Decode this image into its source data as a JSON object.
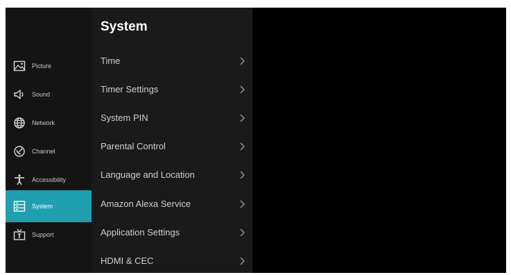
{
  "panel": {
    "title": "System"
  },
  "sidebar": {
    "items": [
      {
        "label": "Picture",
        "icon": "picture-icon"
      },
      {
        "label": "Sound",
        "icon": "speaker-icon"
      },
      {
        "label": "Network",
        "icon": "globe-icon"
      },
      {
        "label": "Channel",
        "icon": "satellite-dish-icon"
      },
      {
        "label": "Accessibility",
        "icon": "accessibility-icon"
      },
      {
        "label": "System",
        "icon": "system-icon",
        "active": true
      },
      {
        "label": "Support",
        "icon": "tv-support-icon"
      }
    ]
  },
  "menu": {
    "items": [
      {
        "label": "Time"
      },
      {
        "label": "Timer Settings"
      },
      {
        "label": "System PIN"
      },
      {
        "label": "Parental Control"
      },
      {
        "label": "Language and Location"
      },
      {
        "label": "Amazon Alexa Service"
      },
      {
        "label": "Application Settings"
      },
      {
        "label": "HDMI & CEC"
      }
    ]
  },
  "colors": {
    "accent": "#1f9fb0",
    "background": "#000000",
    "sidebar": "#141414",
    "panel": "#1a1a1a"
  }
}
